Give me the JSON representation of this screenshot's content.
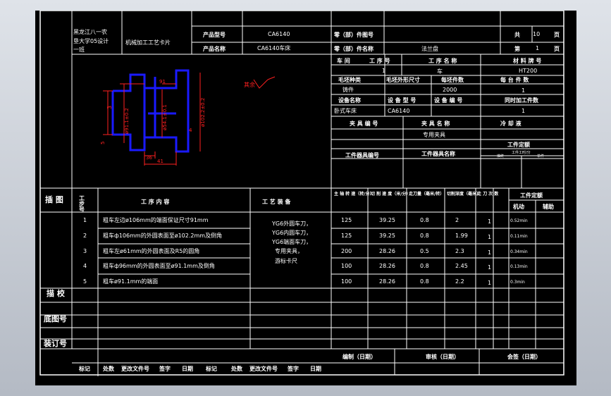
{
  "card": {
    "school": [
      "黑龙江八一农",
      "垦大学05设计",
      "一班"
    ],
    "card_title": "机械加工工艺卡片",
    "product_model_label": "产品型号",
    "product_model": "CA6140",
    "product_name_label": "产品名称",
    "product_name": "CA6140车床",
    "part_no_label": "零（部）件图号",
    "part_name_label": "零（部）件名称",
    "part_name": "法兰盘",
    "total_label": "共",
    "total_pages": "10",
    "page_unit": "页",
    "sheet_label": "第",
    "sheet_no": "1",
    "sheet_unit": "页"
  },
  "info": {
    "workshop_label": "车  间",
    "op_no_label": "工 序 号",
    "op_name_label": "工 序 名 称",
    "material_label": "材 料 牌 号",
    "op_no": "1",
    "op_name": "车",
    "material": "HT200",
    "blank_type_label": "毛坯种类",
    "blank_size_label": "毛坯外形尺寸",
    "blank_count_label": "每坯件数",
    "per_unit_label": "每 台 件 数",
    "blank_type": "铸件",
    "blank_count": "2000",
    "per_unit": "1",
    "equip_name_label": "设备名称",
    "equip_model_label": "设 备 型 号",
    "equip_no_label": "设 备 编 号",
    "concurrent_label": "同时加工件数",
    "equip_name": "卧式车床",
    "equip_model": "CA6140",
    "concurrent": "1",
    "fixture_no_label": "夹 具 编 号",
    "fixture_name_label": "夹 具 名 称",
    "coolant_label": "冷 却 液",
    "fixture_name": "专用夹具",
    "station_tool_no_label": "工件器具编号",
    "station_tool_name_label": "工件器具名称",
    "time_quota_label": "工件定额",
    "time_quota_sub": "工件工时/分",
    "prep_label": "准终",
    "single_label": "单件"
  },
  "drawing": {
    "surface_note": "其余",
    "dims": [
      "3",
      "ø91.1±0.2",
      "ø54.1±0.1",
      "ø102.2±0.2",
      "5",
      "36",
      "41",
      "91",
      "4"
    ]
  },
  "table": {
    "sketch_label": "插 图",
    "headers": {
      "step": "工步号",
      "content": "工  序  内  容",
      "equipment": "工  艺  装  备",
      "speed": "主 轴 转 速（转/分）",
      "cut_speed": "切 削 速 度（米/分）",
      "feed": "走刀量（毫米/转）",
      "depth": "切削深度（毫米）",
      "passes": "走 刀 次 数",
      "time": "工件定额",
      "machine": "机动",
      "aux": "辅助"
    },
    "equipment_lines": [
      "YG6外圆车刀，",
      "YG6内圆车刀，",
      "YG6端面车刀，",
      "专用夹具，",
      "游标卡尺"
    ],
    "rows": [
      {
        "no": "1",
        "content": "粗车左边ø106mm的端面保证尺寸91mm",
        "speed": "125",
        "cut_speed": "39.25",
        "feed": "0.8",
        "depth": "2",
        "passes": "1",
        "time": "0.52min"
      },
      {
        "no": "2",
        "content": "粗车ф106mm的外圆表面至ø102.2mm及倒角",
        "speed": "125",
        "cut_speed": "39.25",
        "feed": "0.8",
        "depth": "1.99",
        "passes": "1",
        "time": "0.11min"
      },
      {
        "no": "3",
        "content": "粗车左ø61mm的外圆表面及R5的圆角",
        "speed": "200",
        "cut_speed": "28.26",
        "feed": "0.5",
        "depth": "2.3",
        "passes": "1",
        "time": "0.34min"
      },
      {
        "no": "4",
        "content": "粗车ф96mm的外圆表面至ø91.1mm及倒角",
        "speed": "100",
        "cut_speed": "28.26",
        "feed": "0.8",
        "depth": "2.45",
        "passes": "1",
        "time": "0.13min"
      },
      {
        "no": "5",
        "content": "粗车ø91.1mm的端面",
        "speed": "100",
        "cut_speed": "28.26",
        "feed": "0.8",
        "depth": "2.2",
        "passes": "1",
        "time": "0.3min"
      }
    ],
    "trace_label": "描 校",
    "base_drawing_label": "底图号",
    "binding_label": "装订号"
  },
  "footer": {
    "compile": "编制（日期）",
    "review": "审核（日期）",
    "sign": "会签（日期）",
    "cols": [
      "标记",
      "处数",
      "更改文件号",
      "签字",
      "日期",
      "标记",
      "处数",
      "更改文件号",
      "签字",
      "日期"
    ]
  },
  "colors": {
    "sheet": "#000000",
    "line": "#ffffff",
    "part": "#1a1aff",
    "dim": "#ff2020",
    "note": "#ff2020"
  }
}
